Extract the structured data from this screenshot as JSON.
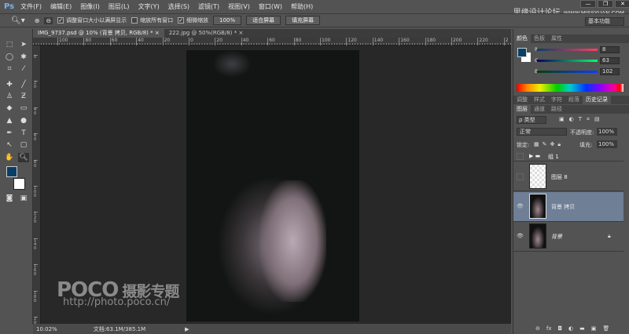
{
  "app": {
    "logo": "Ps",
    "menus": [
      "文件(F)",
      "编辑(E)",
      "图像(I)",
      "图层(L)",
      "文字(Y)",
      "选择(S)",
      "滤镜(T)",
      "视图(V)",
      "窗口(W)",
      "帮助(H)"
    ],
    "watermark": "思缘设计论坛",
    "watermark_url": "WWW.MISSYUAN.COM",
    "window_buttons": [
      "—",
      "❐",
      "✕"
    ]
  },
  "options": {
    "zoom_icon": "magnifier-icon",
    "resize_windows": "调整窗口大小以满屏显示",
    "resize_checked": true,
    "zoom_all": "缩放所有窗口",
    "zoom_all_checked": false,
    "scrubby": "细微缩放",
    "scrubby_checked": true,
    "btn_100": "100%",
    "btn_fit": "适合屏幕",
    "btn_fill": "填充屏幕",
    "workspace": "基本功能"
  },
  "tabs": [
    {
      "label": "IMG_9737.psd @ 10% (背景 拷贝, RGB/8) *",
      "close": "×",
      "active": true
    },
    {
      "label": "222.jpg @ 50%(RGB/8) *",
      "close": "×",
      "active": false
    }
  ],
  "ruler_top": [
    "100",
    "80",
    "60",
    "40",
    "20",
    "0",
    "20",
    "40",
    "60",
    "80",
    "100",
    "120",
    "140",
    "160",
    "180",
    "200",
    "220",
    "2"
  ],
  "ruler_left": [
    "0",
    "20",
    "40",
    "60",
    "80",
    "100",
    "120",
    "140",
    "160",
    "180",
    "200"
  ],
  "canvas_watermark": {
    "brand": "POCO",
    "subtitle": "摄影专题",
    "url": "http://photo.poco.cn/"
  },
  "status": {
    "zoom": "10.02%",
    "doc": "文档:63.1M/385.1M",
    "arrow": "▶"
  },
  "color_panel": {
    "tabs": [
      "颜色",
      "色板",
      "属性"
    ],
    "foreground": "#083f66",
    "channels": [
      {
        "label": "R",
        "value": "8"
      },
      {
        "label": "G",
        "value": "63"
      },
      {
        "label": "B",
        "value": "102"
      }
    ]
  },
  "mid_tabs": [
    "调整",
    "样式",
    "字符",
    "段落",
    "历史记录"
  ],
  "layers_panel": {
    "tabs": [
      "图层",
      "通道",
      "路径"
    ],
    "filter": "ρ 类型",
    "blend": "正常",
    "opacity_label": "不透明度:",
    "opacity": "100%",
    "lock_label": "锁定:",
    "fill_label": "填充:",
    "fill": "100%",
    "layers": [
      {
        "name": "组 1",
        "visible": false,
        "type": "group"
      },
      {
        "name": "图层 8",
        "visible": false,
        "type": "layer"
      },
      {
        "name": "背景 拷贝",
        "visible": true,
        "selected": true
      },
      {
        "name": "背景",
        "visible": true,
        "locked": true
      }
    ],
    "footer_icons": [
      "link-icon",
      "fx-icon",
      "mask-icon",
      "adjustment-icon",
      "folder-icon",
      "new-layer-icon",
      "trash-icon"
    ],
    "footer_glyphs": [
      "⊖",
      "fx",
      "◘",
      "◐",
      "▬",
      "▣",
      "🗑"
    ]
  }
}
